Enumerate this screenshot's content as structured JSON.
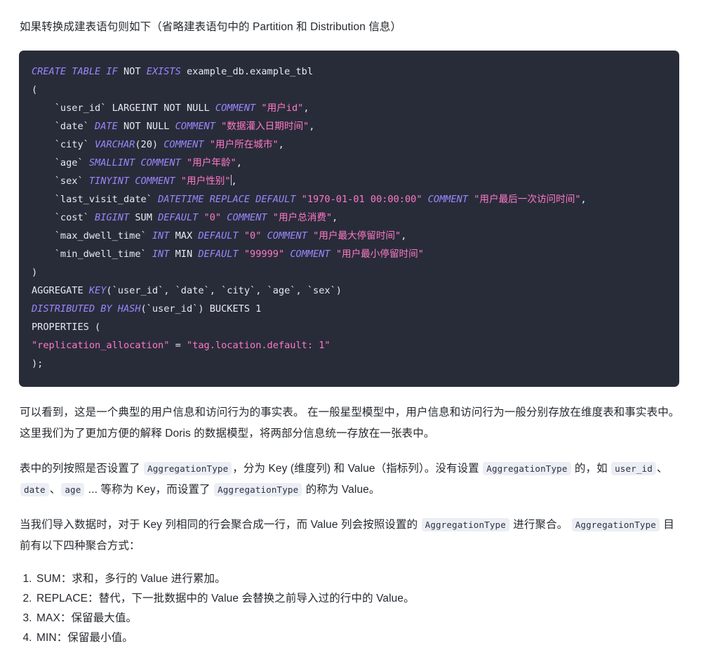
{
  "intro": {
    "text": "如果转换成建表语句则如下（省略建表语句中的 Partition 和 Distribution 信息）"
  },
  "code_block": {
    "language": "sql",
    "background_color": "#282c39",
    "keyword_color": "#9a86fd",
    "string_color": "#ff79c6",
    "plain_color": "#e8e8f0",
    "lines": [
      {
        "tokens": [
          {
            "t": "CREATE TABLE IF",
            "c": "kw"
          },
          {
            "t": " NOT ",
            "c": "pln"
          },
          {
            "t": "EXISTS",
            "c": "kw"
          },
          {
            "t": " example_db.example_tbl",
            "c": "pln"
          }
        ]
      },
      {
        "tokens": [
          {
            "t": "(",
            "c": "pln"
          }
        ]
      },
      {
        "tokens": [
          {
            "t": "    `user_id` LARGEINT NOT NULL ",
            "c": "pln"
          },
          {
            "t": "COMMENT",
            "c": "kw"
          },
          {
            "t": " ",
            "c": "pln"
          },
          {
            "t": "\"用户id\"",
            "c": "str"
          },
          {
            "t": ",",
            "c": "pln"
          }
        ]
      },
      {
        "tokens": [
          {
            "t": "    `date` ",
            "c": "pln"
          },
          {
            "t": "DATE",
            "c": "kw"
          },
          {
            "t": " NOT NULL ",
            "c": "pln"
          },
          {
            "t": "COMMENT",
            "c": "kw"
          },
          {
            "t": " ",
            "c": "pln"
          },
          {
            "t": "\"数据灌入日期时间\"",
            "c": "str"
          },
          {
            "t": ",",
            "c": "pln"
          }
        ]
      },
      {
        "tokens": [
          {
            "t": "    `city` ",
            "c": "pln"
          },
          {
            "t": "VARCHAR",
            "c": "kw"
          },
          {
            "t": "(20) ",
            "c": "pln"
          },
          {
            "t": "COMMENT",
            "c": "kw"
          },
          {
            "t": " ",
            "c": "pln"
          },
          {
            "t": "\"用户所在城市\"",
            "c": "str"
          },
          {
            "t": ",",
            "c": "pln"
          }
        ]
      },
      {
        "tokens": [
          {
            "t": "    `age` ",
            "c": "pln"
          },
          {
            "t": "SMALLINT COMMENT",
            "c": "kw"
          },
          {
            "t": " ",
            "c": "pln"
          },
          {
            "t": "\"用户年龄\"",
            "c": "str"
          },
          {
            "t": ",",
            "c": "pln"
          }
        ]
      },
      {
        "tokens": [
          {
            "t": "    `sex` ",
            "c": "pln"
          },
          {
            "t": "TINYINT COMMENT",
            "c": "kw"
          },
          {
            "t": " ",
            "c": "pln"
          },
          {
            "t": "\"用户性别\"",
            "c": "str"
          },
          {
            "t": "CARET",
            "c": "caret"
          },
          {
            "t": ",",
            "c": "pln"
          }
        ]
      },
      {
        "tokens": [
          {
            "t": "    `last_visit_date` ",
            "c": "pln"
          },
          {
            "t": "DATETIME REPLACE DEFAULT",
            "c": "kw"
          },
          {
            "t": " ",
            "c": "pln"
          },
          {
            "t": "\"1970-01-01 00:00:00\"",
            "c": "str"
          },
          {
            "t": " ",
            "c": "pln"
          },
          {
            "t": "COMMENT",
            "c": "kw"
          },
          {
            "t": " ",
            "c": "pln"
          },
          {
            "t": "\"用户最后一次访问时间\"",
            "c": "str"
          },
          {
            "t": ",",
            "c": "pln"
          }
        ]
      },
      {
        "tokens": [
          {
            "t": "    `cost` ",
            "c": "pln"
          },
          {
            "t": "BIGINT",
            "c": "kw"
          },
          {
            "t": " SUM ",
            "c": "pln"
          },
          {
            "t": "DEFAULT",
            "c": "kw"
          },
          {
            "t": " ",
            "c": "pln"
          },
          {
            "t": "\"0\"",
            "c": "str"
          },
          {
            "t": " ",
            "c": "pln"
          },
          {
            "t": "COMMENT",
            "c": "kw"
          },
          {
            "t": " ",
            "c": "pln"
          },
          {
            "t": "\"用户总消费\"",
            "c": "str"
          },
          {
            "t": ",",
            "c": "pln"
          }
        ]
      },
      {
        "tokens": [
          {
            "t": "    `max_dwell_time` ",
            "c": "pln"
          },
          {
            "t": "INT",
            "c": "kw"
          },
          {
            "t": " MAX ",
            "c": "pln"
          },
          {
            "t": "DEFAULT",
            "c": "kw"
          },
          {
            "t": " ",
            "c": "pln"
          },
          {
            "t": "\"0\"",
            "c": "str"
          },
          {
            "t": " ",
            "c": "pln"
          },
          {
            "t": "COMMENT",
            "c": "kw"
          },
          {
            "t": " ",
            "c": "pln"
          },
          {
            "t": "\"用户最大停留时间\"",
            "c": "str"
          },
          {
            "t": ",",
            "c": "pln"
          }
        ]
      },
      {
        "tokens": [
          {
            "t": "    `min_dwell_time` ",
            "c": "pln"
          },
          {
            "t": "INT",
            "c": "kw"
          },
          {
            "t": " MIN ",
            "c": "pln"
          },
          {
            "t": "DEFAULT",
            "c": "kw"
          },
          {
            "t": " ",
            "c": "pln"
          },
          {
            "t": "\"99999\"",
            "c": "str"
          },
          {
            "t": " ",
            "c": "pln"
          },
          {
            "t": "COMMENT",
            "c": "kw"
          },
          {
            "t": " ",
            "c": "pln"
          },
          {
            "t": "\"用户最小停留时间\"",
            "c": "str"
          }
        ]
      },
      {
        "tokens": [
          {
            "t": ")",
            "c": "pln"
          }
        ]
      },
      {
        "tokens": [
          {
            "t": "AGGREGATE ",
            "c": "pln"
          },
          {
            "t": "KEY",
            "c": "kw"
          },
          {
            "t": "(`user_id`, `date`, `city`, `age`, `sex`)",
            "c": "pln"
          }
        ]
      },
      {
        "tokens": [
          {
            "t": "DISTRIBUTED BY HASH",
            "c": "kw"
          },
          {
            "t": "(`user_id`) BUCKETS 1",
            "c": "pln"
          }
        ]
      },
      {
        "tokens": [
          {
            "t": "PROPERTIES (",
            "c": "pln"
          }
        ]
      },
      {
        "tokens": [
          {
            "t": "\"replication_allocation\"",
            "c": "str"
          },
          {
            "t": " = ",
            "c": "pln"
          },
          {
            "t": "\"tag.location.default: 1\"",
            "c": "str"
          }
        ]
      },
      {
        "tokens": [
          {
            "t": ");",
            "c": "pln"
          }
        ]
      }
    ]
  },
  "paragraphs": [
    {
      "id": "p-fact-table",
      "runs": [
        {
          "t": "可以看到，这是一个典型的用户信息和访问行为的事实表。 在一般星型模型中，用户信息和访问行为一般分别存放在维度表和事实表中。这里我们为了更加方便的解释 Doris 的数据模型，将两部分信息统一存放在一张表中。",
          "c": "text"
        }
      ]
    },
    {
      "id": "p-key-value",
      "runs": [
        {
          "t": "表中的列按照是否设置了 ",
          "c": "text"
        },
        {
          "t": "AggregationType",
          "c": "code"
        },
        {
          "t": "，分为 Key (维度列) 和 Value（指标列）。没有设置 ",
          "c": "text"
        },
        {
          "t": "AggregationType",
          "c": "code"
        },
        {
          "t": " 的，如 ",
          "c": "text"
        },
        {
          "t": "user_id",
          "c": "code"
        },
        {
          "t": "、",
          "c": "text"
        },
        {
          "t": "date",
          "c": "code"
        },
        {
          "t": "、",
          "c": "text"
        },
        {
          "t": "age",
          "c": "code"
        },
        {
          "t": " ... 等称为 Key，而设置了 ",
          "c": "text"
        },
        {
          "t": "AggregationType",
          "c": "code"
        },
        {
          "t": " 的称为 Value。",
          "c": "text"
        }
      ]
    },
    {
      "id": "p-import",
      "runs": [
        {
          "t": "当我们导入数据时，对于 Key 列相同的行会聚合成一行，而 Value 列会按照设置的 ",
          "c": "text"
        },
        {
          "t": "AggregationType",
          "c": "code"
        },
        {
          "t": " 进行聚合。 ",
          "c": "text"
        },
        {
          "t": "AggregationType",
          "c": "code"
        },
        {
          "t": " 目前有以下四种聚合方式：",
          "c": "text"
        }
      ]
    }
  ],
  "aggregation_list": {
    "items": [
      "SUM：求和，多行的 Value 进行累加。",
      "REPLACE：替代，下一批数据中的 Value 会替换之前导入过的行中的 Value。",
      "MAX：保留最大值。",
      "MIN：保留最小值。"
    ]
  }
}
